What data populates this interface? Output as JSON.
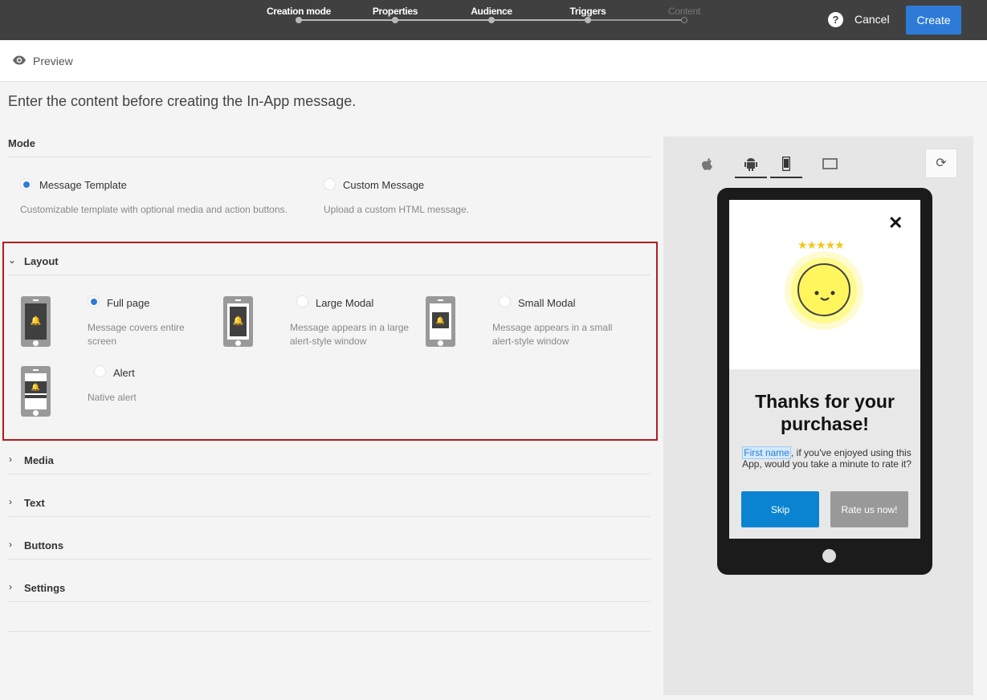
{
  "header": {
    "steps": [
      {
        "label": "Creation mode"
      },
      {
        "label": "Properties"
      },
      {
        "label": "Audience"
      },
      {
        "label": "Triggers"
      },
      {
        "label": "Content"
      }
    ],
    "help": "?",
    "cancel": "Cancel",
    "create": "Create"
  },
  "preview_bar": {
    "label": "Preview"
  },
  "intro": "Enter the content before creating the In-App message.",
  "mode": {
    "title": "Mode",
    "options": [
      {
        "label": "Message Template",
        "desc": "Customizable template with optional media and action buttons.",
        "selected": true
      },
      {
        "label": "Custom Message",
        "desc": "Upload a custom HTML message.",
        "selected": false
      }
    ]
  },
  "layout": {
    "title": "Layout",
    "options": [
      {
        "label": "Full page",
        "desc": "Message covers entire screen",
        "selected": true
      },
      {
        "label": "Large Modal",
        "desc": "Message appears in a large alert-style window",
        "selected": false
      },
      {
        "label": "Small Modal",
        "desc": "Message appears in a small alert-style window",
        "selected": false
      },
      {
        "label": "Alert",
        "desc": "Native alert",
        "selected": false
      }
    ]
  },
  "sections": [
    {
      "title": "Media"
    },
    {
      "title": "Text"
    },
    {
      "title": "Buttons"
    },
    {
      "title": "Settings"
    }
  ],
  "preview": {
    "close": "✕",
    "stars": "★★★★★",
    "title": "Thanks for your purchase!",
    "personalization": "First name",
    "body": ", if you've enjoyed using this App, would you take a minute to rate it?",
    "skip": "Skip",
    "rate": "Rate us now!"
  },
  "colors": {
    "accent": "#2d7bd6",
    "highlight": "#b31b1b",
    "topbar": "#404040"
  }
}
